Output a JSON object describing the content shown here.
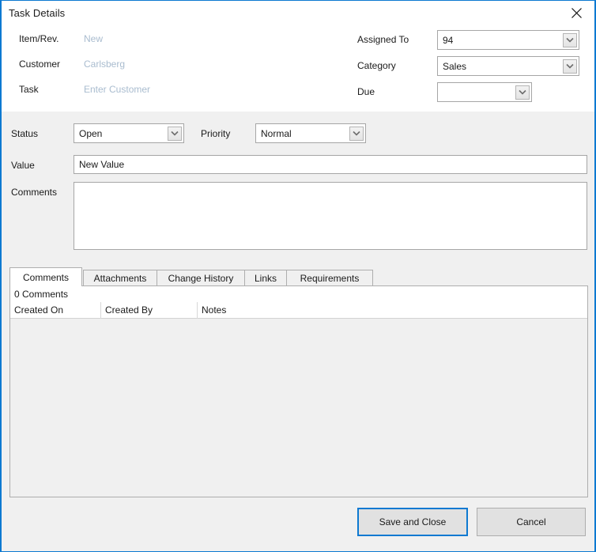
{
  "window": {
    "title": "Task Details",
    "close_icon": "close-icon",
    "accent_color": "#0d79d1",
    "body_bg": "#f0f0f0"
  },
  "header": {
    "fields": [
      {
        "label": "Item/Rev.",
        "value": "New"
      },
      {
        "label": "Customer",
        "value": "Carlsberg"
      },
      {
        "label": "Task",
        "value": "Enter Customer"
      }
    ],
    "right_fields": [
      {
        "label": "Assigned To",
        "value": "94",
        "icon": "chevron-down-icon"
      },
      {
        "label": "Category",
        "value": "Sales",
        "icon": "chevron-down-icon"
      },
      {
        "label": "Due",
        "value": "",
        "icon": "chevron-down-icon"
      }
    ]
  },
  "form": {
    "status": {
      "label": "Status",
      "value": "Open",
      "icon": "chevron-down-icon"
    },
    "priority": {
      "label": "Priority",
      "value": "Normal",
      "icon": "chevron-down-icon"
    },
    "value": {
      "label": "Value",
      "value": "New Value",
      "placeholder": ""
    },
    "comments": {
      "label": "Comments",
      "value": "",
      "placeholder": ""
    }
  },
  "tabs": [
    {
      "label": "Comments",
      "selected": true
    },
    {
      "label": "Attachments",
      "selected": false
    },
    {
      "label": "Change History",
      "selected": false
    },
    {
      "label": "Links",
      "selected": false
    },
    {
      "label": "Requirements",
      "selected": false
    }
  ],
  "grid": {
    "count_text": "0 Comments",
    "columns": [
      "Created On",
      "Created By",
      "Notes"
    ],
    "rows": []
  },
  "footer": {
    "save_label": "Save and Close",
    "cancel_label": "Cancel"
  }
}
